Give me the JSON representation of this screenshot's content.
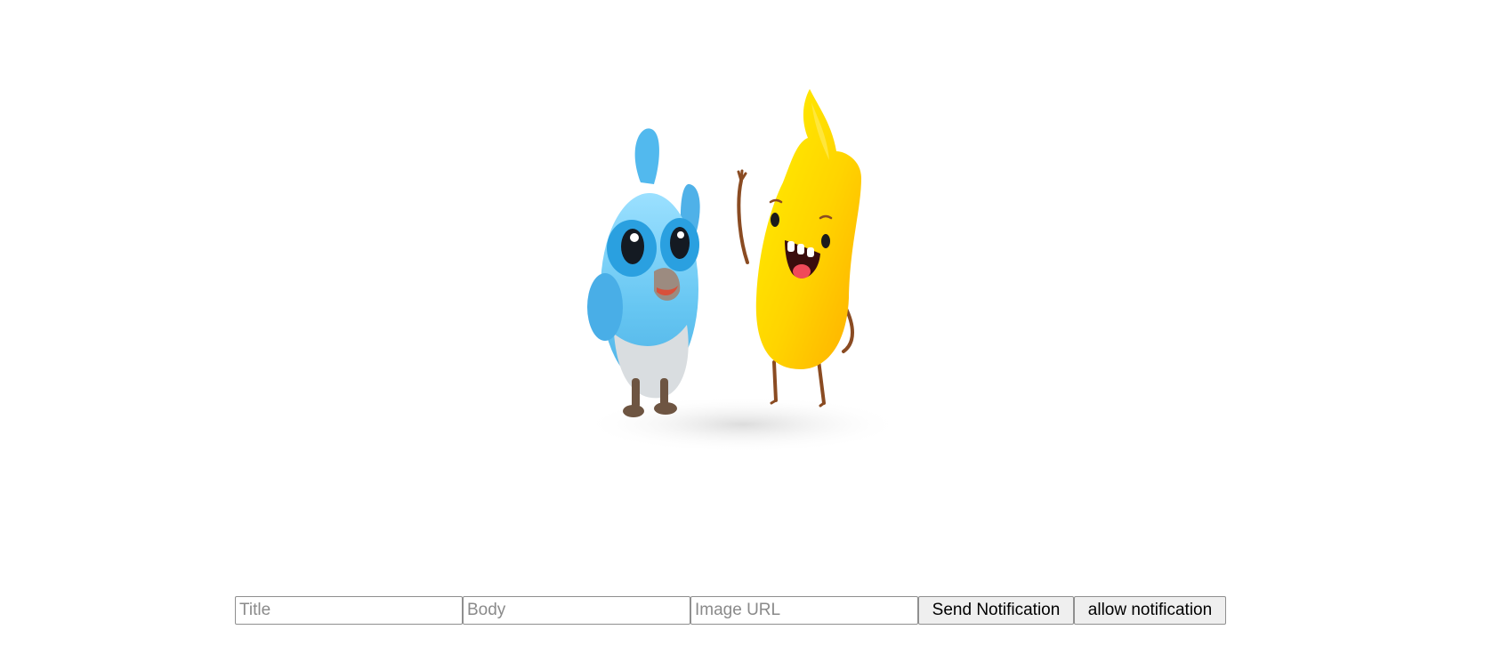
{
  "hero": {
    "image_description_icon": "duolingo-style-mascots-icon",
    "characters": [
      "blue-bird-mascot-icon",
      "yellow-flame-mascot-icon"
    ]
  },
  "form": {
    "title_placeholder": "Title",
    "body_placeholder": "Body",
    "image_url_placeholder": "Image URL",
    "send_label": "Send Notification",
    "allow_label": "allow notification"
  },
  "colors": {
    "bird_blue": "#5fc1ef",
    "bird_dark_blue": "#2a9fe0",
    "flame_yellow": "#ffd600",
    "flame_orange": "#ffb300"
  }
}
